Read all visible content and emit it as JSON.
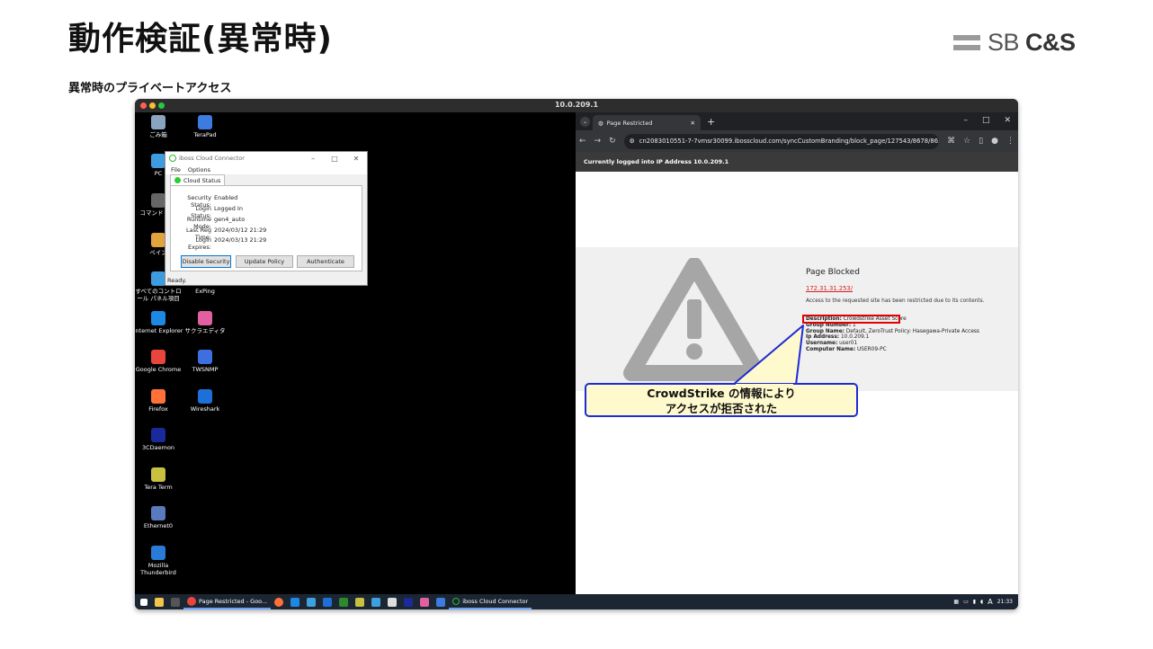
{
  "slide": {
    "title": "動作検証(異常時)",
    "subtitle": "異常時のプライベートアクセス",
    "logo": {
      "bars_color": "#9a9a9a",
      "text_sb": "SB",
      "text_cs": "C&S"
    }
  },
  "mac_window": {
    "title": "10.0.209.1",
    "dot_colors": [
      "#ff5f57",
      "#febc2e",
      "#28c840"
    ]
  },
  "desktop_icons": [
    {
      "label": "ごみ箱",
      "icon": "recycle-bin-icon",
      "color": "#8aa4c0"
    },
    {
      "label": "TeraPad",
      "icon": "terapad-icon",
      "color": "#3e7be0"
    },
    {
      "label": "PC",
      "icon": "pc-icon",
      "color": "#3e9be0"
    },
    {
      "label": "コマンド プロ",
      "icon": "command-prompt-icon",
      "color": "#666666"
    },
    {
      "label": "ペイン",
      "icon": "paint-icon",
      "color": "#e0a43e"
    },
    {
      "label": "すべてのコントロール パネル項目",
      "icon": "control-panel-icon",
      "color": "#3e9be0"
    },
    {
      "label": "ExPing",
      "icon": "exping-icon",
      "color": "#3ea0e0"
    },
    {
      "label": "Internet Explorer",
      "icon": "internet-explorer-icon",
      "color": "#1e88e5"
    },
    {
      "label": "サクラエディタ",
      "icon": "sakura-editor-icon",
      "color": "#e060a0"
    },
    {
      "label": "Google Chrome",
      "icon": "chrome-icon",
      "color": "#e8453c"
    },
    {
      "label": "TWSNMP",
      "icon": "twsnmp-icon",
      "color": "#3e6fe0"
    },
    {
      "label": "Firefox",
      "icon": "firefox-icon",
      "color": "#ff7139"
    },
    {
      "label": "Wireshark",
      "icon": "wireshark-icon",
      "color": "#1f6fd8"
    },
    {
      "label": "3CDaemon",
      "icon": "3cdaemon-icon",
      "color": "#1a2a9a"
    },
    {
      "label": "Tera Term",
      "icon": "teraterm-icon",
      "color": "#c8c040"
    },
    {
      "label": "Ethernet0",
      "icon": "ethernet-icon",
      "color": "#5a7ac0"
    },
    {
      "label": "Mozilla Thunderbird",
      "icon": "thunderbird-icon",
      "color": "#2a7ad8"
    }
  ],
  "iboss": {
    "title": "iboss Cloud Connector",
    "menu": [
      "File",
      "Options"
    ],
    "tab": "Cloud Status",
    "status": [
      {
        "k": "Security Status:",
        "v": "Enabled"
      },
      {
        "k": "Login Status:",
        "v": "Logged In"
      },
      {
        "k": "Runtime Mode:",
        "v": "gen4_auto"
      },
      {
        "k": "Last Reg Time:",
        "v": "2024/03/12 21:29"
      },
      {
        "k": "Login Expires:",
        "v": "2024/03/13 21:29"
      }
    ],
    "buttons": {
      "disable": "Disable Security",
      "update": "Update Policy",
      "auth": "Authenticate"
    },
    "statusbar": "Ready."
  },
  "taskbar": {
    "chrome_app": "Page Restricted - Goo...",
    "iboss_app": "iboss Cloud Connector",
    "ime": "A",
    "time": "21:33",
    "bg": "#1c2532"
  },
  "browser": {
    "tab_title": "Page Restricted",
    "new_tab": "+",
    "url": "cn2083010551-7-7vmsr30099.ibosscloud.com/syncCustomBranding/block_page/127543/8678/86...",
    "logged_in": "Currently logged into IP Address 10.0.209.1",
    "block": {
      "title": "Page Blocked",
      "url": "172.31.31.253/",
      "message": "Access to the requested site has been restricted due to its contents.",
      "details": [
        {
          "k": "Description:",
          "v": "Crowdstrike Asset Score"
        },
        {
          "k": "Group Number:",
          "v": "1"
        },
        {
          "k": "Group Name:",
          "v": "Default, ZeroTrust Policy: Hasegawa-Private Access"
        },
        {
          "k": "Ip Address:",
          "v": "10.0.209.1"
        },
        {
          "k": "Username:",
          "v": "user01"
        },
        {
          "k": "Computer Name:",
          "v": "USER09-PC"
        }
      ]
    }
  },
  "callout": {
    "line1": "CrowdStrike の情報により",
    "line2": "アクセスが拒否された",
    "border": "#1f2bd6",
    "fill": "#fffacd"
  }
}
